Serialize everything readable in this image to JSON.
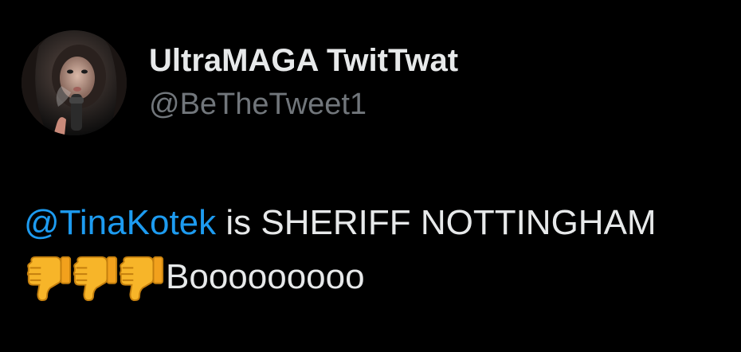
{
  "user": {
    "display_name": "UltraMAGA TwitTwat",
    "handle": "@BeTheTweet1"
  },
  "tweet": {
    "mention": "@TinaKotek",
    "text_after_mention": " is SHERIFF NOTTINGHAM",
    "emojis": [
      "thumbs-down-icon",
      "thumbs-down-icon",
      "thumbs-down-icon"
    ],
    "trailing_text": "Booooooooo"
  },
  "colors": {
    "background": "#000000",
    "primary_text": "#e7e9ea",
    "secondary_text": "#71767b",
    "mention": "#1d9bf0"
  }
}
